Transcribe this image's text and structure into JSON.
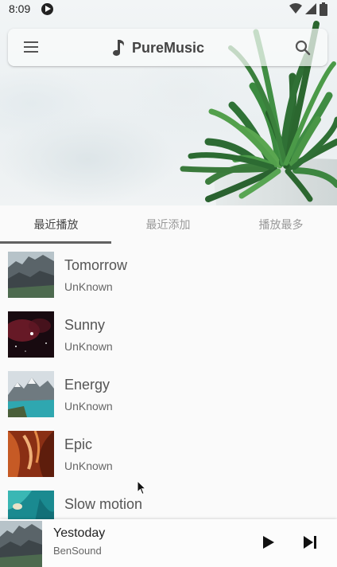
{
  "status_bar": {
    "time": "8:09"
  },
  "app": {
    "title": "PureMusic"
  },
  "tabs": [
    {
      "label": "最近播放",
      "active": true
    },
    {
      "label": "最近添加",
      "active": false
    },
    {
      "label": "播放最多",
      "active": false
    }
  ],
  "songs": [
    {
      "title": "Tomorrow",
      "artist": "UnKnown",
      "art": "mountain-cliff"
    },
    {
      "title": "Sunny",
      "artist": "UnKnown",
      "art": "red-nebula"
    },
    {
      "title": "Energy",
      "artist": "UnKnown",
      "art": "lake-mountains"
    },
    {
      "title": "Epic",
      "artist": "UnKnown",
      "art": "canyon"
    },
    {
      "title": "Slow motion",
      "artist": "",
      "art": "turquoise-water"
    }
  ],
  "now_playing": {
    "title": "Yestoday",
    "artist": "BenSound",
    "art": "mountain-cliff"
  },
  "colors": {
    "tab_indicator": "#616161",
    "icon": "#555555"
  }
}
